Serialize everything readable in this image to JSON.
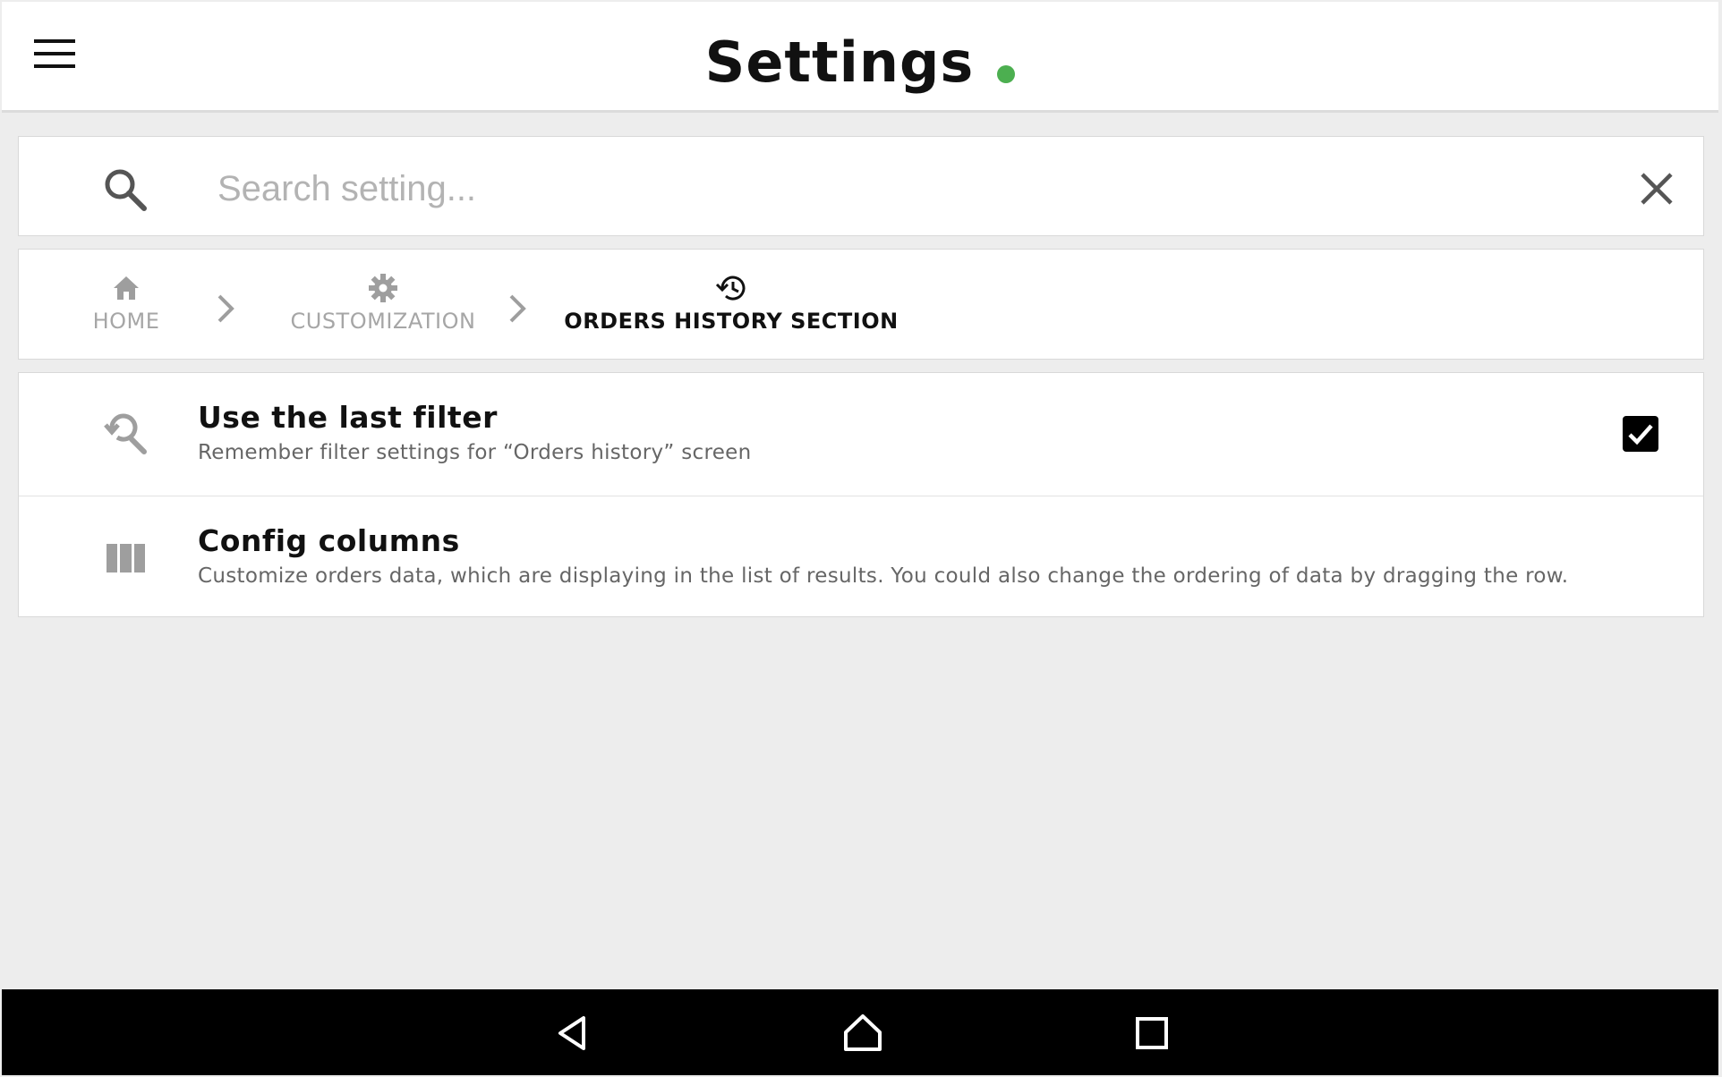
{
  "app_bar": {
    "title": "Settings",
    "status_color": "#4caf50",
    "menu_icon": "hamburger-menu-icon"
  },
  "search": {
    "placeholder": "Search setting...",
    "value": "",
    "search_icon": "search-icon",
    "clear_icon": "close-icon"
  },
  "breadcrumb": [
    {
      "label": "HOME",
      "icon": "home-icon",
      "active": false
    },
    {
      "label": "CUSTOMIZATION",
      "icon": "gear-icon",
      "active": false
    },
    {
      "label": "ORDERS HISTORY SECTION",
      "icon": "history-icon",
      "active": true
    }
  ],
  "settings": [
    {
      "title": "Use the last filter",
      "subtitle": "Remember filter settings for “Orders history” screen",
      "icon": "search-history-icon",
      "checked": true
    },
    {
      "title": "Config columns",
      "subtitle": "Customize orders data, which are displaying in the list of results. You could also change the ordering of data by dragging the row.",
      "icon": "columns-icon"
    }
  ],
  "nav_bar": {
    "icons": [
      "back-icon",
      "home-icon",
      "recents-icon"
    ]
  }
}
